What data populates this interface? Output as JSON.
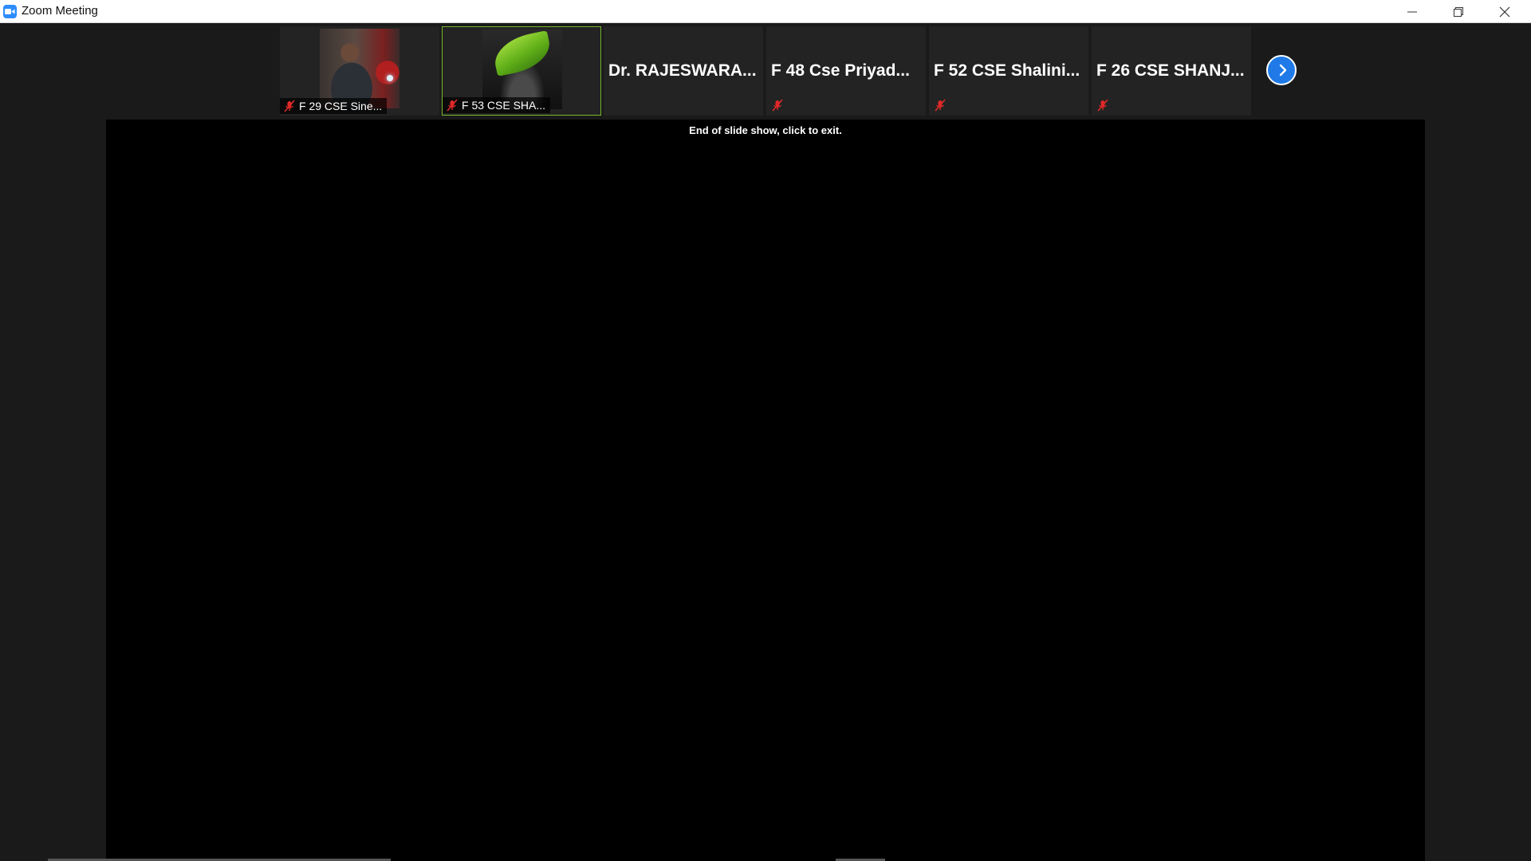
{
  "window": {
    "title": "Zoom Meeting",
    "app_icon": "zoom-icon",
    "controls": [
      "minimize-icon",
      "restore-icon",
      "close-icon"
    ]
  },
  "participants": [
    {
      "name": "F 29 CSE Sine...",
      "video": "photo",
      "muted": true,
      "active": false
    },
    {
      "name": "F 53 CSE SHA...",
      "video": "photo",
      "muted": true,
      "active": true
    },
    {
      "name": "Dr.  RAJESWARA...",
      "video": "off",
      "muted": false,
      "active": false
    },
    {
      "name": "F 48 Cse Priyad...",
      "video": "off",
      "muted": true,
      "active": false
    },
    {
      "name": "F 52 CSE Shalini...",
      "video": "off",
      "muted": true,
      "active": false
    },
    {
      "name": "F 26 CSE SHANJ...",
      "video": "off",
      "muted": true,
      "active": false
    }
  ],
  "strip": {
    "next_icon": "chevron-right-icon"
  },
  "shared_screen": {
    "message": "End of slide show, click to exit."
  },
  "colors": {
    "active_border": "#76b82a",
    "mute_red": "#e02828",
    "next_button": "#1f7ae8",
    "zoom_blue": "#2d8cff"
  }
}
